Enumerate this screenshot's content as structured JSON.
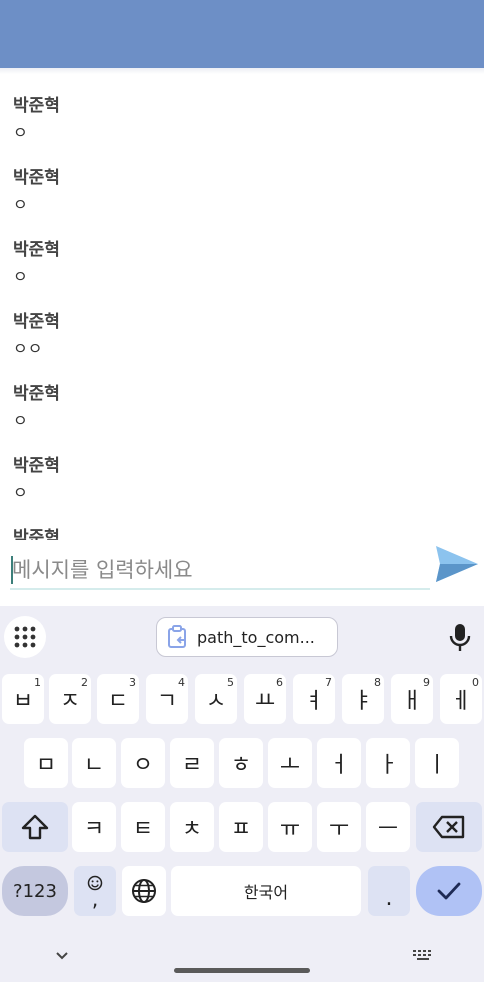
{
  "messages": [
    {
      "sender": "박준혁",
      "text": "ㅇ"
    },
    {
      "sender": "박준혁",
      "text": "ㅇ"
    },
    {
      "sender": "박준혁",
      "text": "ㅇ"
    },
    {
      "sender": "박준혁",
      "text": "ㅇㅇ"
    },
    {
      "sender": "박준혁",
      "text": "ㅇ"
    },
    {
      "sender": "박준혁",
      "text": "ㅇ"
    },
    {
      "sender": "박준혁",
      "text": ""
    }
  ],
  "composer": {
    "placeholder": "메시지를 입력하세요",
    "value": ""
  },
  "keyboard": {
    "clipboard_chip": "path_to_com...",
    "row1": [
      {
        "label": "ㅂ",
        "hint": "1"
      },
      {
        "label": "ㅈ",
        "hint": "2"
      },
      {
        "label": "ㄷ",
        "hint": "3"
      },
      {
        "label": "ㄱ",
        "hint": "4"
      },
      {
        "label": "ㅅ",
        "hint": "5"
      },
      {
        "label": "ㅛ",
        "hint": "6"
      },
      {
        "label": "ㅕ",
        "hint": "7"
      },
      {
        "label": "ㅑ",
        "hint": "8"
      },
      {
        "label": "ㅐ",
        "hint": "9"
      },
      {
        "label": "ㅔ",
        "hint": "0"
      }
    ],
    "row2": [
      "ㅁ",
      "ㄴ",
      "ㅇ",
      "ㄹ",
      "ㅎ",
      "ㅗ",
      "ㅓ",
      "ㅏ",
      "ㅣ"
    ],
    "row3": [
      "ㅋ",
      "ㅌ",
      "ㅊ",
      "ㅍ",
      "ㅠ",
      "ㅜ",
      "ㅡ"
    ],
    "symbols_label": "?123",
    "comma_label": ",",
    "space_label": "한국어",
    "period_label": "."
  },
  "colors": {
    "app_bar": "#6d8fc6",
    "send_icon": "#6fa8dc",
    "keyboard_bg": "#eeeef6",
    "enter_key": "#b0c2f5"
  },
  "icons": {
    "send": "send-icon",
    "apps": "apps-grid-icon",
    "clipboard": "clipboard-link-icon",
    "mic": "mic-icon",
    "shift": "shift-icon",
    "backspace": "backspace-icon",
    "emoji": "emoji-icon",
    "globe": "globe-icon",
    "enter": "check-icon",
    "hide_keyboard": "chevron-down-icon",
    "keyboard_switch": "keyboard-icon"
  }
}
